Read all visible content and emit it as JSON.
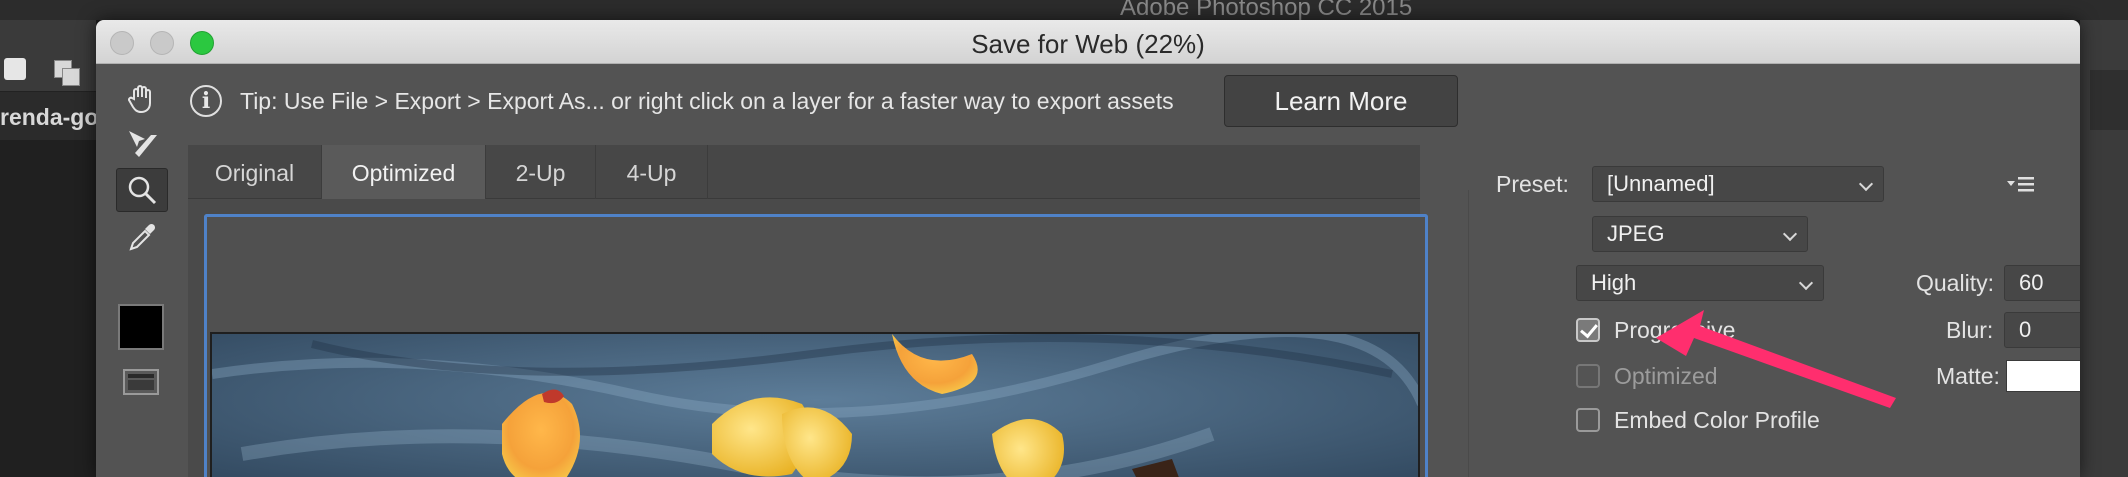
{
  "app": {
    "title": "Adobe Photoshop CC 2015",
    "doc_tab_label": "renda-go"
  },
  "dialog": {
    "title": "Save for Web (22%)"
  },
  "tools": [
    {
      "name": "hand-tool",
      "icon": "hand-icon"
    },
    {
      "name": "slice-select-tool",
      "icon": "slice-select-icon"
    },
    {
      "name": "zoom-tool",
      "icon": "zoom-icon"
    },
    {
      "name": "eyedropper-tool",
      "icon": "eyedropper-icon"
    }
  ],
  "tip": {
    "icon": "info-icon",
    "text": "Tip: Use File > Export > Export As...  or right click on a layer for a faster way to export assets",
    "button_label": "Learn More"
  },
  "view_tabs": [
    {
      "label": "Original",
      "active": false
    },
    {
      "label": "Optimized",
      "active": true
    },
    {
      "label": "2-Up",
      "active": false
    },
    {
      "label": "4-Up",
      "active": false
    }
  ],
  "settings": {
    "preset_label": "Preset:",
    "preset_value": "[Unnamed]",
    "format_value": "JPEG",
    "quality_level_value": "High",
    "quality_label": "Quality:",
    "quality_value": "60",
    "blur_label": "Blur:",
    "blur_value": "0",
    "matte_label": "Matte:",
    "matte_color": "#ffffff",
    "progressive_label": "Progressive",
    "progressive_checked": true,
    "optimized_label": "Optimized",
    "optimized_checked": false,
    "embed_profile_label": "Embed Color Profile",
    "embed_profile_checked": false
  },
  "colors": {
    "accent_frame": "#4f82c8",
    "arrow": "#ff2e6e",
    "zoom_button": "#2bc840",
    "foreground_swatch": "#000000"
  }
}
